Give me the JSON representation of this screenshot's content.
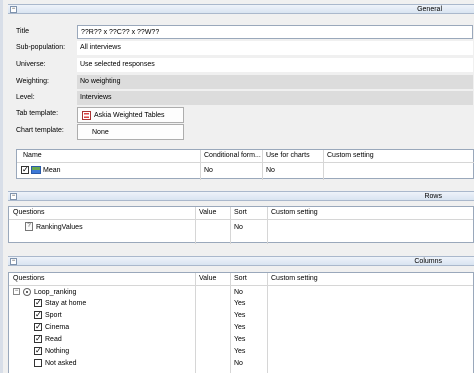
{
  "general": {
    "section_title": "General",
    "title_label": "Title",
    "title_value": "??R?? x ??C?? x ??W??",
    "subpop_label": "Sub-population:",
    "subpop_value": "All interviews",
    "universe_label": "Universe:",
    "universe_value": "Use selected responses",
    "weighting_label": "Weighting:",
    "weighting_value": "No weighting",
    "level_label": "Level:",
    "level_value": "Interviews",
    "tab_template_label": "Tab template:",
    "tab_template_value": "Askia Weighted Tables",
    "chart_template_label": "Chart template:",
    "chart_template_value": "None"
  },
  "stats_grid": {
    "headers": [
      "Name",
      "Conditional form...",
      "Use for charts",
      "Custom setting"
    ],
    "rows": [
      {
        "name": "Mean",
        "conditional": "No",
        "use_for_charts": "No",
        "custom": "",
        "checked": true
      }
    ]
  },
  "rows": {
    "section_title": "Rows",
    "headers": [
      "Questions",
      "Value",
      "Sort",
      "Custom setting"
    ],
    "items": [
      {
        "label": "RankingValues",
        "value": "",
        "sort": "No"
      }
    ]
  },
  "columns": {
    "section_title": "Columns",
    "headers": [
      "Questions",
      "Value",
      "Sort",
      "Custom setting"
    ],
    "parent": {
      "label": "Loop_ranking",
      "sort": "No"
    },
    "items": [
      {
        "label": "Stay at home",
        "sort": "Yes",
        "checked": true
      },
      {
        "label": "Sport",
        "sort": "Yes",
        "checked": true
      },
      {
        "label": "Cinema",
        "sort": "Yes",
        "checked": true
      },
      {
        "label": "Read",
        "sort": "Yes",
        "checked": true
      },
      {
        "label": "Nothing",
        "sort": "Yes",
        "checked": true
      },
      {
        "label": "Not asked",
        "sort": "No",
        "checked": false
      }
    ]
  }
}
